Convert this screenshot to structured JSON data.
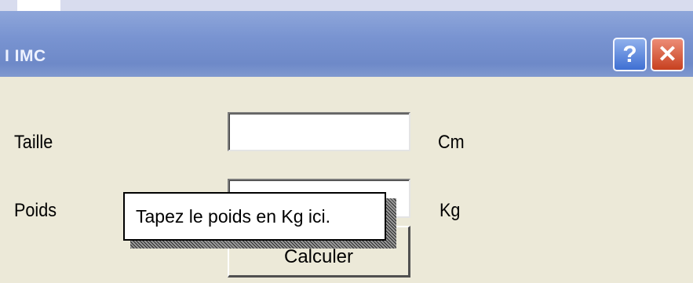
{
  "window": {
    "title": "I IMC",
    "help_label": "?",
    "close_label": "✕"
  },
  "form": {
    "height_label": "Taille",
    "height_value": "",
    "height_unit": "Cm",
    "weight_label": "Poids",
    "weight_value": "",
    "weight_unit": "Kg",
    "calculate_label": "Calculer"
  },
  "tooltip": {
    "text": "Tapez le poids en Kg ici."
  }
}
